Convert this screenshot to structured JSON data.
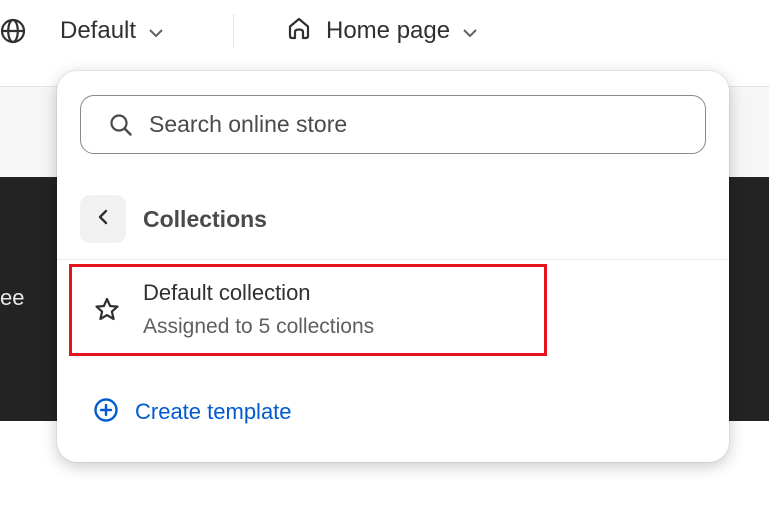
{
  "topbar": {
    "theme_selector": {
      "icon": "globe-icon",
      "label": "Default"
    },
    "page_selector": {
      "icon": "home-icon",
      "label": "Home page"
    }
  },
  "background": {
    "band_text": "ee"
  },
  "dropdown": {
    "search": {
      "placeholder": "Search online store",
      "value": ""
    },
    "section": {
      "back_icon": "chevron-left-icon",
      "title": "Collections"
    },
    "items": [
      {
        "icon": "star-icon",
        "title": "Default collection",
        "subtitle": "Assigned to 5 collections",
        "highlighted": true
      }
    ],
    "create": {
      "icon": "plus-circle-icon",
      "label": "Create template"
    }
  },
  "colors": {
    "highlight": "#e5141b",
    "link": "#005bd3",
    "dark_band": "#232323"
  }
}
